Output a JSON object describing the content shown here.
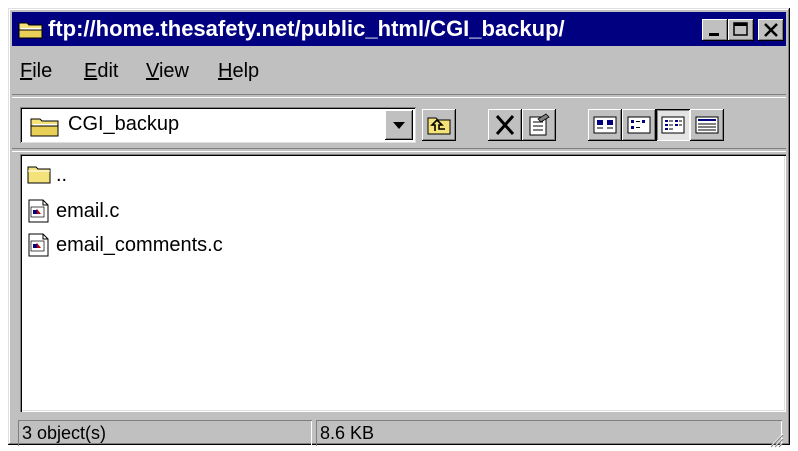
{
  "window": {
    "title": "ftp://home.thesafety.net/public_html/CGI_backup/",
    "title_icon": "ftp-folder-icon",
    "controls": [
      "minimize-icon",
      "maximize-icon",
      "close-icon"
    ]
  },
  "menu": {
    "items": [
      {
        "label": "File"
      },
      {
        "label": "Edit"
      },
      {
        "label": "View"
      },
      {
        "label": "Help"
      }
    ]
  },
  "toolbar": {
    "address_value": "CGI_backup",
    "address_icon": "ftp-folder-icon",
    "buttons": [
      "up-one-level-icon",
      "delete-icon",
      "properties-icon",
      "large-icons-view-icon",
      "small-icons-view-icon",
      "list-view-icon",
      "details-view-icon"
    ],
    "active_view": "list-view-icon"
  },
  "files": [
    {
      "name": "..",
      "icon": "folder-icon"
    },
    {
      "name": "email.c",
      "icon": "c-source-file-icon"
    },
    {
      "name": "email_comments.c",
      "icon": "c-source-file-icon"
    }
  ],
  "status": {
    "objects": "3 object(s)",
    "size": "8.6 KB"
  },
  "colors": {
    "titlebar": "#000080",
    "face": "#c0c0c0",
    "folder": "#f4e27a"
  }
}
